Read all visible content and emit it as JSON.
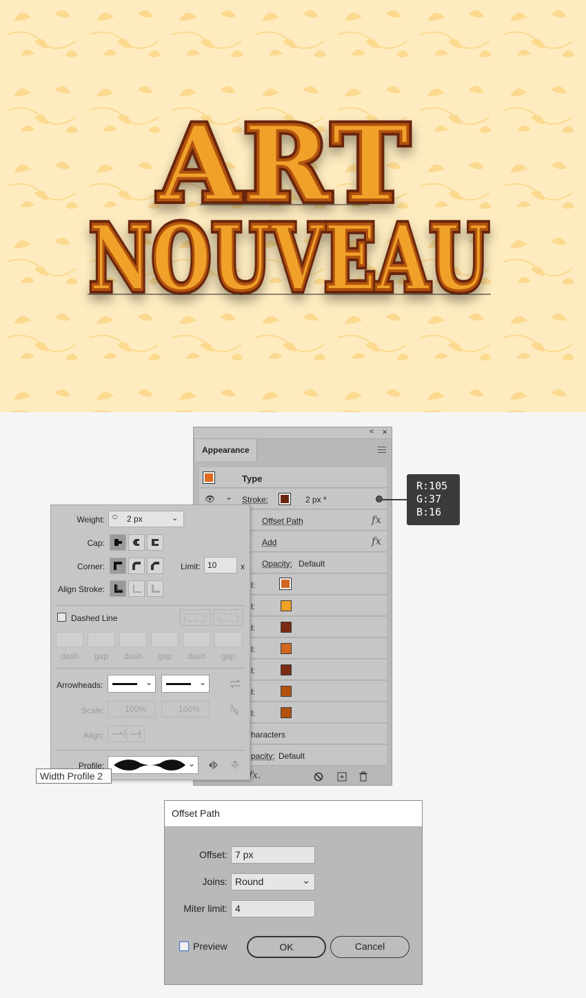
{
  "artwork": {
    "line1": "ART",
    "line2": "NOUVEAU",
    "colors": {
      "background": "#feebbf",
      "pattern": "#fbd98f",
      "fill_orange": "#f0a12a",
      "fill_light": "#f6b43d",
      "stroke_dark": "#69250f",
      "mid": "#b3520f"
    }
  },
  "appearance": {
    "tab": "Appearance",
    "collapse_icon": "«",
    "close_icon": "×",
    "type_label": "Type",
    "stroke_label": "Stroke:",
    "stroke_value": "2 px *",
    "rows": [
      {
        "label": "Offset Path",
        "fx": "fx"
      },
      {
        "label": "Add",
        "fx": "fx"
      },
      {
        "label": "Opacity:",
        "value": "Default"
      }
    ],
    "fills": [
      {
        "label": "l:",
        "color": "#d2661e"
      },
      {
        "label": "l:",
        "color": "#f0a12a"
      },
      {
        "label": "l:",
        "color": "#7a2b14"
      },
      {
        "label": "l:",
        "color": "#d2661e"
      },
      {
        "label": "l:",
        "color": "#7a2b14"
      },
      {
        "label": "l:",
        "color": "#b3520f"
      },
      {
        "label": "l:",
        "color": "#b3520f"
      }
    ],
    "characters": "haracters",
    "opacity2_label": "pacity:",
    "opacity2_value": "Default",
    "stroke_swatch": "#69250f",
    "type_swatch": "#e06a1d",
    "fx_footer": "fx."
  },
  "rgb_callout": {
    "r": "R:105",
    "g": "G:37",
    "b": "B:16"
  },
  "stroke_panel": {
    "weight_label": "Weight:",
    "weight_value": "2 px",
    "cap_label": "Cap:",
    "corner_label": "Corner:",
    "limit_label": "Limit:",
    "limit_value": "10",
    "limit_unit": "x",
    "align_label": "Align Stroke:",
    "dashed_label": "Dashed Line",
    "dash_labels": [
      "dash",
      "gap",
      "dash",
      "gap",
      "dash",
      "gap"
    ],
    "arrowheads_label": "Arrowheads:",
    "scale_label": "Scale:",
    "scale_1": "100%",
    "scale_2": "100%",
    "align2_label": "Align:",
    "profile_label": "Profile:"
  },
  "tooltip": "Width Profile 2",
  "offset_dialog": {
    "title": "Offset Path",
    "offset_label": "Offset:",
    "offset_value": "7 px",
    "joins_label": "Joins:",
    "joins_value": "Round",
    "miter_label": "Miter limit:",
    "miter_value": "4",
    "preview_label": "Preview",
    "ok_label": "OK",
    "cancel_label": "Cancel"
  }
}
